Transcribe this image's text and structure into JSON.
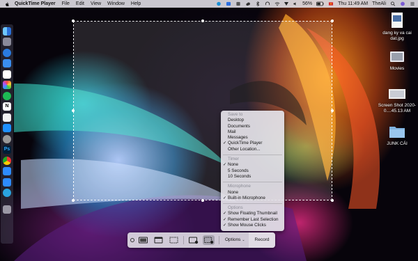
{
  "menubar": {
    "app_name": "QuickTime Player",
    "menus": [
      "File",
      "Edit",
      "View",
      "Window",
      "Help"
    ],
    "battery": "56%",
    "clock": "Thu 11:49 AM",
    "user": "TheAli"
  },
  "desktop_icons": [
    {
      "label": "dang ky va cai dat.jpg"
    },
    {
      "label": "Movies"
    },
    {
      "label": "Screen Shot 2020-0....45.13 AM"
    },
    {
      "label": "JUNK CÁI"
    }
  ],
  "dock": {
    "apps": [
      "finder",
      "launchpad",
      "safari",
      "mail",
      "calendar",
      "photos",
      "spotify",
      "notion",
      "music",
      "app-store",
      "settings",
      "photoshop",
      "chrome",
      "zalo",
      "zoom",
      "telegram",
      "trash"
    ]
  },
  "options_menu": {
    "save_to": {
      "header": "Save to",
      "items": [
        {
          "label": "Desktop",
          "checked": false
        },
        {
          "label": "Documents",
          "checked": false
        },
        {
          "label": "Mail",
          "checked": false
        },
        {
          "label": "Messages",
          "checked": false
        },
        {
          "label": "QuickTime Player",
          "checked": true
        },
        {
          "label": "Other Location...",
          "checked": false
        }
      ]
    },
    "timer": {
      "header": "Timer",
      "items": [
        {
          "label": "None",
          "checked": true
        },
        {
          "label": "5 Seconds",
          "checked": false
        },
        {
          "label": "10 Seconds",
          "checked": false
        }
      ]
    },
    "microphone": {
      "header": "Microphone",
      "items": [
        {
          "label": "None",
          "checked": false
        },
        {
          "label": "Built-in Microphone",
          "checked": true
        }
      ]
    },
    "options": {
      "header": "Options",
      "items": [
        {
          "label": "Show Floating Thumbnail",
          "checked": true
        },
        {
          "label": "Remember Last Selection",
          "checked": true
        },
        {
          "label": "Show Mouse Clicks",
          "checked": true
        }
      ]
    }
  },
  "toolbar": {
    "options_label": "Options",
    "record_label": "Record"
  },
  "colors": {
    "menubar": "#e6e4eb",
    "menu_bg": "#e4e2e8",
    "header_text": "#8b8b95"
  }
}
